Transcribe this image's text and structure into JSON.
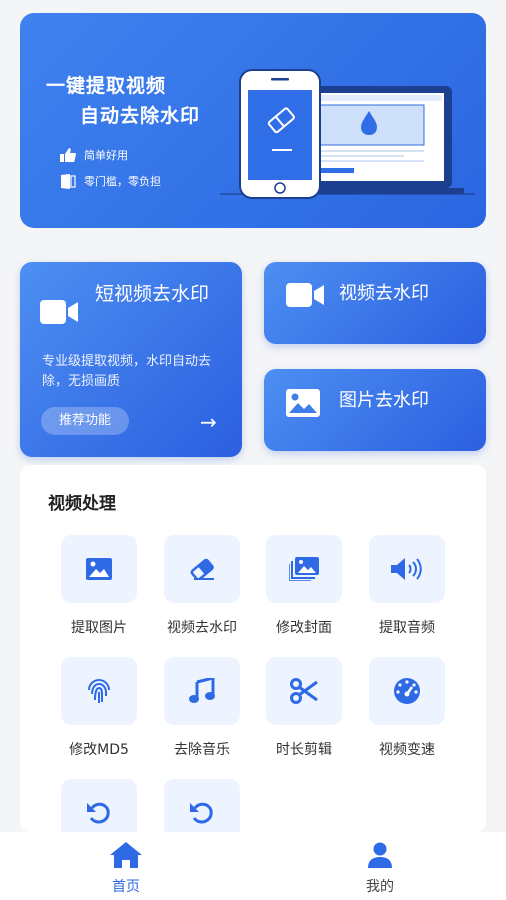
{
  "banner": {
    "line1": "一键提取视频",
    "line2": "自动去除水印",
    "feature1": "简单好用",
    "feature2": "零门槛，零负担"
  },
  "cards": {
    "short_video": {
      "title": "短视频去水印",
      "desc": "专业级提取视频，水印自动去除，无损画质",
      "tag": "推荐功能",
      "arrow": "→"
    },
    "video": {
      "title": "视频去水印"
    },
    "image": {
      "title": "图片去水印"
    }
  },
  "panel": {
    "title": "视频处理",
    "tools": [
      {
        "label": "提取图片",
        "icon": "image-icon"
      },
      {
        "label": "视频去水印",
        "icon": "eraser-icon"
      },
      {
        "label": "修改封面",
        "icon": "images-stack-icon"
      },
      {
        "label": "提取音频",
        "icon": "speaker-icon"
      },
      {
        "label": "修改MD5",
        "icon": "fingerprint-icon"
      },
      {
        "label": "去除音乐",
        "icon": "music-note-icon"
      },
      {
        "label": "时长剪辑",
        "icon": "scissors-icon"
      },
      {
        "label": "视频变速",
        "icon": "speedometer-icon"
      },
      {
        "label": "",
        "icon": "undo-icon"
      },
      {
        "label": "",
        "icon": "undo-icon"
      }
    ]
  },
  "nav": {
    "home": "首页",
    "mine": "我的"
  },
  "colors": {
    "accent": "#2e6ae6",
    "tool_bg": "#eef4ff"
  }
}
